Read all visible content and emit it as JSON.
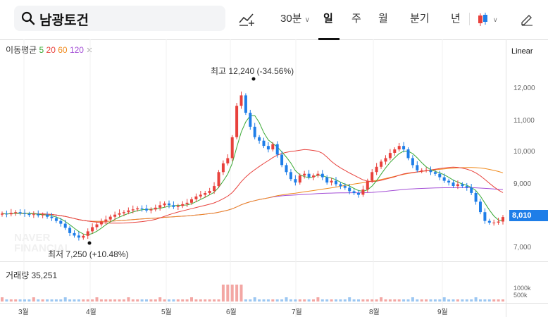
{
  "search": {
    "stock_name": "남광토건"
  },
  "toolbar": {
    "interval_label": "30분",
    "tabs": [
      "일",
      "주",
      "월",
      "분기",
      "년"
    ],
    "active_tab": "일"
  },
  "indicators": {
    "moving_average_label": "이동평균",
    "periods": [
      {
        "label": "5",
        "color": "#3aa935"
      },
      {
        "label": "20",
        "color": "#e8413c"
      },
      {
        "label": "60",
        "color": "#f08a1c"
      },
      {
        "label": "120",
        "color": "#a44fd6"
      }
    ],
    "scale_label": "Linear"
  },
  "price_axis": {
    "ticks": [
      "12,000",
      "11,000",
      "10,000",
      "9,000",
      "8,000",
      "7,000"
    ],
    "current_price": "8,010"
  },
  "annotations": {
    "high": "최고 12,240 (-34.56%)",
    "low": "최저 7,250 (+10.48%)"
  },
  "volume": {
    "label": "거래량 35,251",
    "axis_ticks": [
      "1000k",
      "500k"
    ]
  },
  "watermark": "NAVER FINANCIAL",
  "x_axis": {
    "months": [
      "3월",
      "4월",
      "5월",
      "6월",
      "7월",
      "8월",
      "9월"
    ]
  },
  "colors": {
    "up": "#e8413c",
    "down": "#1e7ee8",
    "ma5": "#3aa935",
    "ma20": "#e8413c",
    "ma60": "#f08a1c",
    "ma120": "#a44fd6"
  },
  "chart_data": {
    "type": "candlestick",
    "y_range": [
      6800,
      12700
    ],
    "series": [
      {
        "name": "price",
        "values": [
          8110,
          8090,
          8130,
          8150,
          8120,
          8100,
          8070,
          8090,
          8060,
          8080,
          8020,
          7980,
          7900,
          7820,
          7700,
          7550,
          7480,
          7420,
          7470,
          7600,
          7720,
          7800,
          7880,
          7940,
          8020,
          8080,
          8120,
          8150,
          8200,
          8230,
          8260,
          8250,
          8200,
          8230,
          8280,
          8350,
          8400,
          8350,
          8300,
          8330,
          8380,
          8420,
          8520,
          8600,
          8650,
          8700,
          8760,
          8900,
          9300,
          9550,
          9700,
          10300,
          11200,
          11500,
          11000,
          10600,
          10300,
          10200,
          10050,
          9950,
          10100,
          9800,
          9500,
          9300,
          9100,
          9000,
          9200,
          9250,
          9150,
          9200,
          9250,
          9150,
          9000,
          9050,
          8950,
          8900,
          8850,
          8750,
          8700,
          8650,
          8800,
          9050,
          9300,
          9450,
          9600,
          9700,
          9850,
          9950,
          10050,
          9950,
          9700,
          9500,
          9350,
          9350,
          9350,
          9300,
          9250,
          9150,
          9050,
          9000,
          8900,
          8950,
          8900,
          8850,
          8700,
          8450,
          8150,
          7900,
          7850,
          7850,
          7880,
          8010
        ]
      }
    ]
  }
}
